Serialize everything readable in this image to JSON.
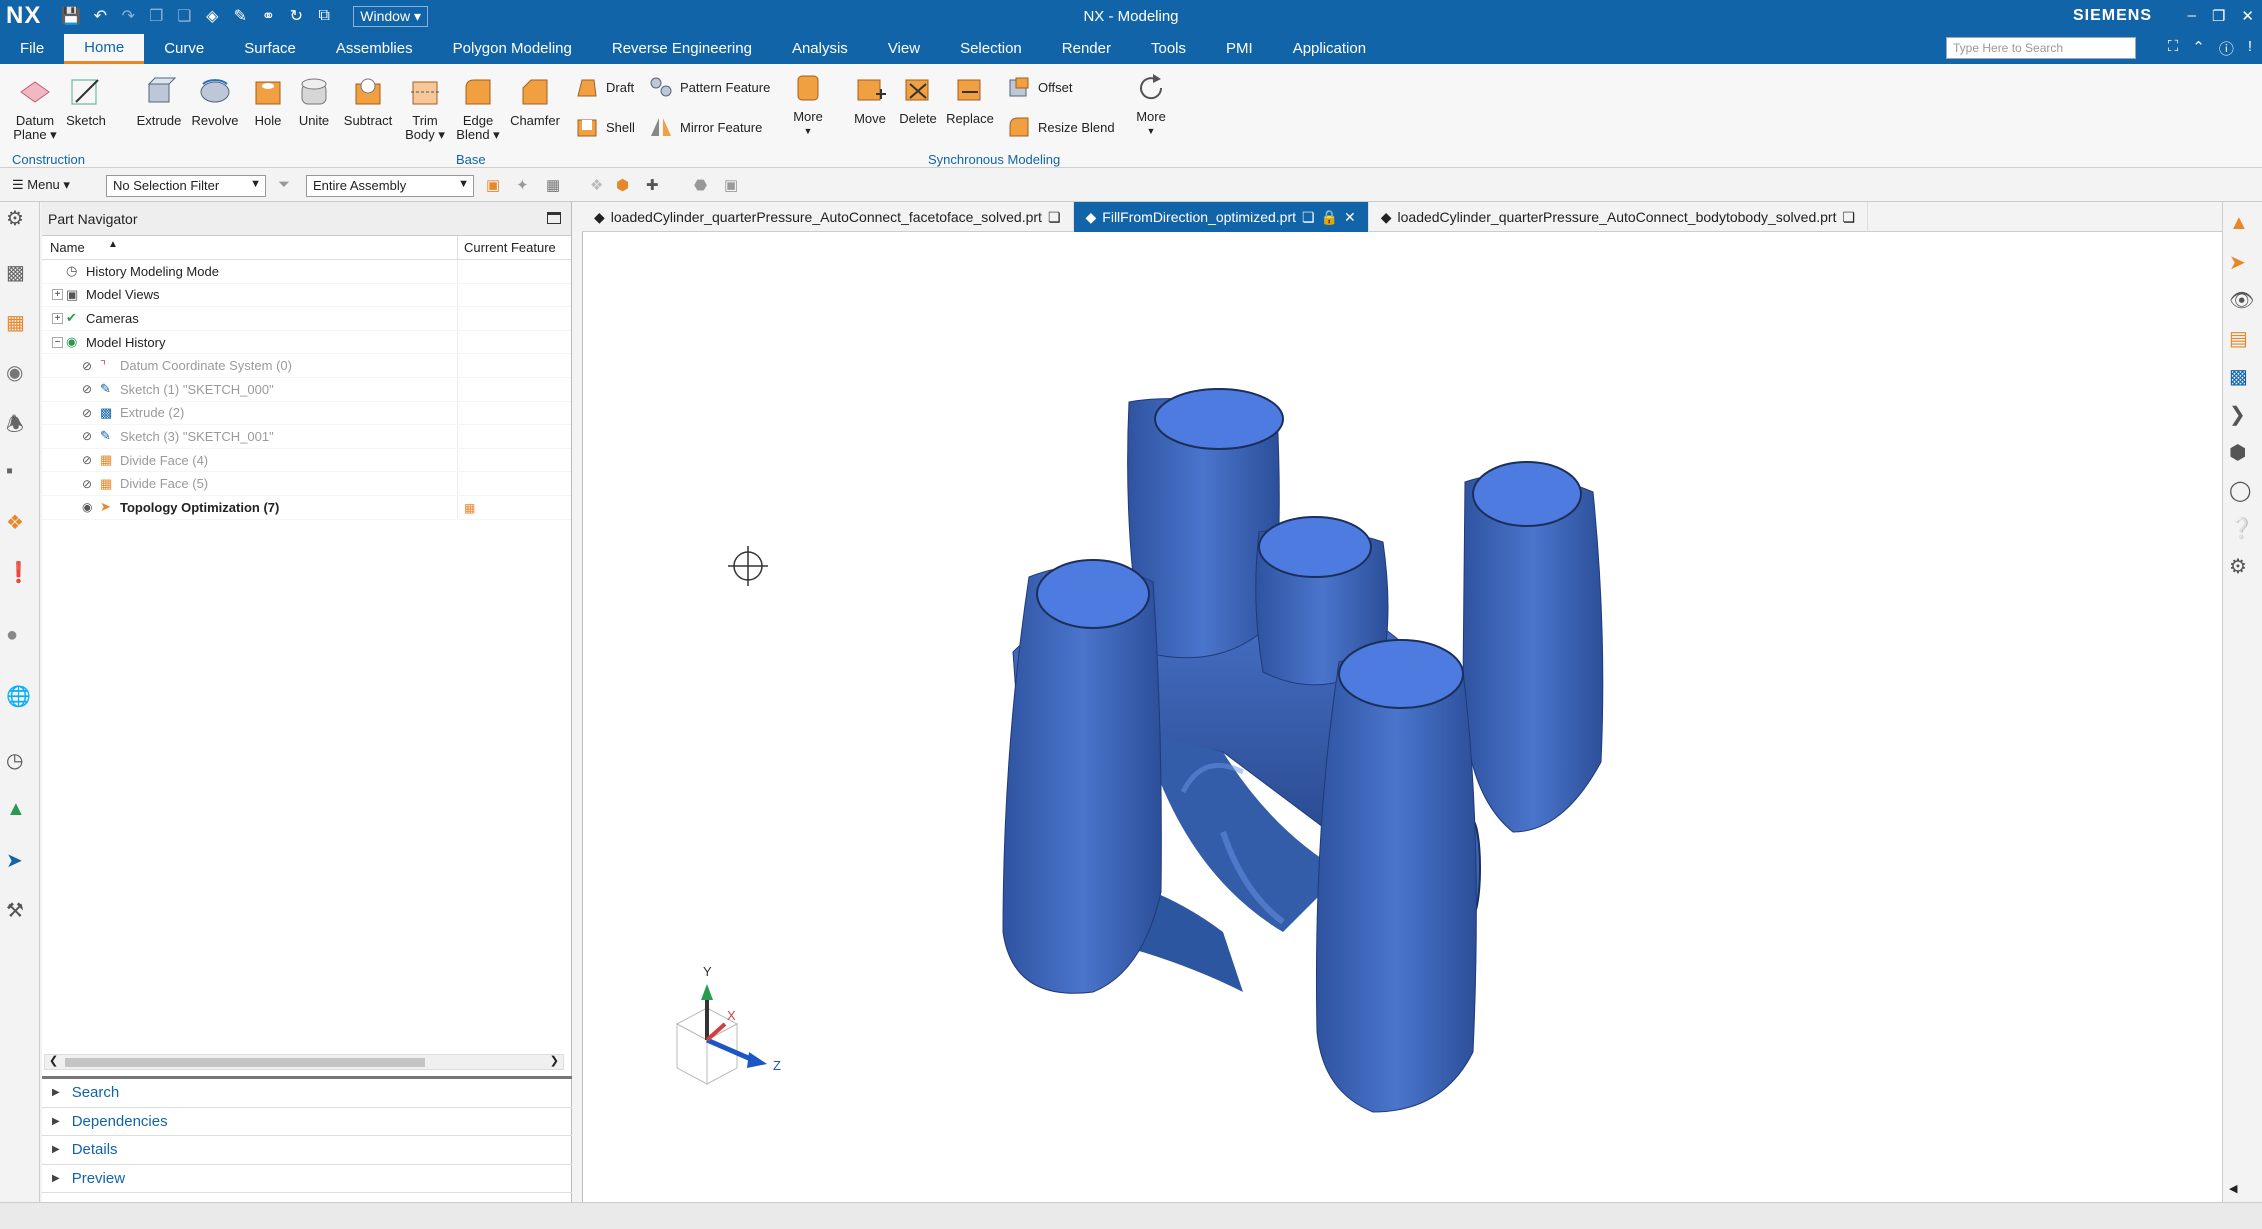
{
  "app": {
    "logo": "NX",
    "title": "NX - Modeling",
    "brand": "SIEMENS",
    "window_menu": "Window ▾"
  },
  "menu_tabs": [
    "File",
    "Home",
    "Curve",
    "Surface",
    "Assemblies",
    "Polygon Modeling",
    "Reverse Engineering",
    "Analysis",
    "View",
    "Selection",
    "Render",
    "Tools",
    "PMI",
    "Application"
  ],
  "active_tab": "Home",
  "search": {
    "placeholder": "Type Here to Search"
  },
  "ribbon": {
    "buttons": {
      "datum_plane": "Datum Plane ▾",
      "sketch": "Sketch",
      "extrude": "Extrude",
      "revolve": "Revolve",
      "hole": "Hole",
      "unite": "Unite",
      "subtract": "Subtract",
      "trim_body": "Trim Body ▾",
      "edge_blend": "Edge Blend ▾",
      "chamfer": "Chamfer",
      "draft": "Draft",
      "shell": "Shell",
      "pattern_feature": "Pattern Feature",
      "mirror_feature": "Mirror Feature",
      "more1": "More",
      "move": "Move",
      "delete": "Delete",
      "replace": "Replace",
      "offset": "Offset",
      "resize_blend": "Resize Blend",
      "more2": "More"
    },
    "groups": {
      "construction": "Construction",
      "base": "Base",
      "synchronous": "Synchronous Modeling"
    }
  },
  "selection_bar": {
    "menu": "☰ Menu ▾",
    "filter": "No Selection Filter",
    "scope": "Entire Assembly"
  },
  "navigator": {
    "title": "Part Navigator",
    "col_name": "Name",
    "col_feature": "Current Feature",
    "rows": [
      {
        "label": "History Modeling Mode",
        "icon": "clock-icon",
        "indent": 0,
        "exp": ""
      },
      {
        "label": "Model Views",
        "icon": "views-icon",
        "indent": 0,
        "exp": "+"
      },
      {
        "label": "Cameras",
        "icon": "camera-icon",
        "indent": 0,
        "exp": "+"
      },
      {
        "label": "Model History",
        "icon": "history-icon",
        "indent": 0,
        "exp": "−"
      },
      {
        "label": "Datum Coordinate System (0)",
        "icon": "datum-csys-icon",
        "indent": 1,
        "exp": ""
      },
      {
        "label": "Sketch (1) \"SKETCH_000\"",
        "icon": "sketch-icon",
        "indent": 1,
        "exp": ""
      },
      {
        "label": "Extrude (2)",
        "icon": "extrude-icon",
        "indent": 1,
        "exp": ""
      },
      {
        "label": "Sketch (3) \"SKETCH_001\"",
        "icon": "sketch-icon",
        "indent": 1,
        "exp": ""
      },
      {
        "label": "Divide Face (4)",
        "icon": "divide-face-icon",
        "indent": 1,
        "exp": ""
      },
      {
        "label": "Divide Face (5)",
        "icon": "divide-face-icon",
        "indent": 1,
        "exp": ""
      },
      {
        "label": "Topology Optimization (7)",
        "icon": "topology-icon",
        "indent": 1,
        "exp": ""
      }
    ],
    "sections": [
      "Search",
      "Dependencies",
      "Details",
      "Preview"
    ]
  },
  "doc_tabs": [
    {
      "label": "loadedCylinder_quarterPressure_AutoConnect_facetoface_solved.prt",
      "active": false
    },
    {
      "label": "FillFromDirection_optimized.prt",
      "active": true
    },
    {
      "label": "loadedCylinder_quarterPressure_AutoConnect_bodytobody_solved.prt",
      "active": false
    }
  ],
  "triad": {
    "x": "X",
    "y": "Y",
    "z": "Z"
  },
  "colors": {
    "titlebar": "#1264a8",
    "model": "#3b65b8",
    "model_top": "#5c86d9",
    "accent": "#e8862a"
  }
}
